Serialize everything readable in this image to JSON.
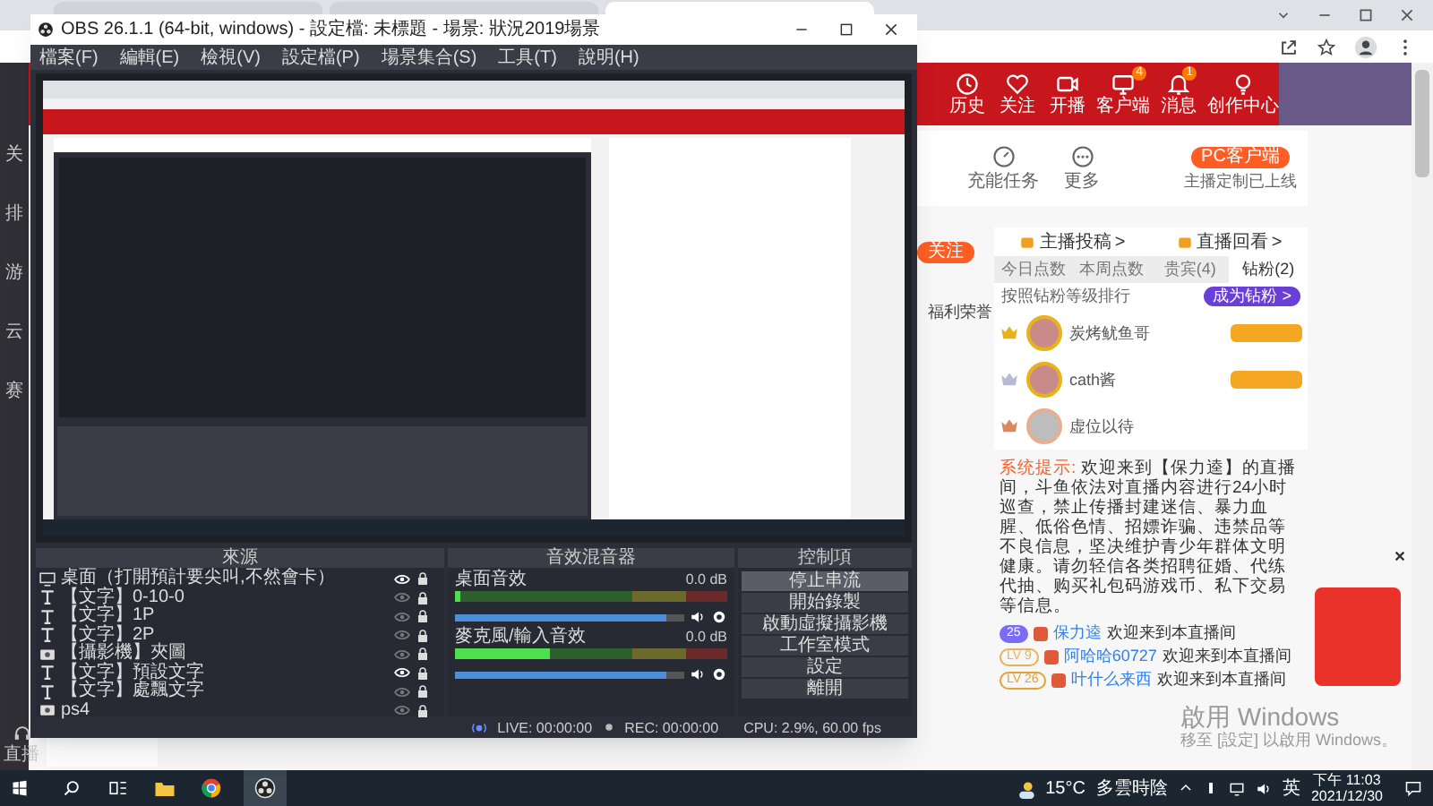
{
  "browser": {
    "tabs": [
      {
        "selected": false
      },
      {
        "selected": false
      },
      {
        "selected": true
      }
    ]
  },
  "sidebar": {
    "items": [
      "关",
      "排",
      "游",
      "云",
      "赛"
    ]
  },
  "header": {
    "nav_items": [
      {
        "label": "历史",
        "kind": "clock"
      },
      {
        "label": "关注",
        "kind": "heart"
      },
      {
        "label": "开播",
        "kind": "camera"
      },
      {
        "label": "客户端",
        "kind": "client",
        "badge": "4"
      },
      {
        "label": "消息",
        "kind": "bell",
        "badge": "1"
      },
      {
        "label": "创作中心",
        "kind": "bulb"
      }
    ]
  },
  "tools": {
    "items": [
      {
        "label": "充能任务",
        "kind": "gauge"
      },
      {
        "label": "更多",
        "kind": "more"
      }
    ],
    "client_button": "PC客户端",
    "client_note": "主播定制已上线"
  },
  "follow_button": "关注",
  "side_note": "福利荣誉",
  "links": [
    {
      "label": "主播投稿",
      "arrow": ">"
    },
    {
      "label": "直播回看",
      "arrow": ">"
    }
  ],
  "rank_tabs": [
    {
      "label": "今日点数",
      "selected": false
    },
    {
      "label": "本周点数",
      "selected": false
    },
    {
      "label": "贵宾(4)",
      "selected": false
    },
    {
      "label": "钻粉(2)",
      "selected": true
    }
  ],
  "rank_hint": "按照钻粉等级排行",
  "join_button": "成为钻粉 >",
  "rank": [
    {
      "name": "炭烤鱿鱼哥",
      "color": "#e8b21c",
      "avatar": true
    },
    {
      "name": "cath酱",
      "color": "#b9b9d6",
      "avatar": true
    },
    {
      "name": "虚位以待",
      "color": "#d98a5a",
      "avatar": false
    }
  ],
  "notice": {
    "label": "系统提示:",
    "text": "欢迎来到【保力逵】的直播间，斗鱼依法对直播内容进行24小时巡查，禁止传播封建迷信、暴力血腥、低俗色情、招嫖诈骗、违禁品等不良信息，坚决维护青少年群体文明健康。请勿轻信各类招聘征婚、代练代抽、购买礼包码游戏币、私下交易等信息。"
  },
  "chat": [
    {
      "level": "25",
      "color": "#7b6cf6",
      "user": "保力逵",
      "message": "欢迎来到本直播间"
    },
    {
      "level": "LV 9",
      "color": "#e3b25a",
      "user": "阿哈哈60727",
      "message": "欢迎来到本直播间"
    },
    {
      "level": "LV 26",
      "color": "#e8a030",
      "user": "叶什么来西",
      "message": "欢迎来到本直播间"
    }
  ],
  "activation": {
    "title": "啟用 Windows",
    "note": "移至 [設定] 以啟用 Windows。"
  },
  "live_label": "直播",
  "obs": {
    "title": "OBS 26.1.1 (64-bit, windows) - 設定檔: 未標題 - 場景: 狀況2019場景",
    "menu": [
      "檔案(F)",
      "編輯(E)",
      "檢視(V)",
      "設定檔(P)",
      "場景集合(S)",
      "工具(T)",
      "說明(H)"
    ],
    "sources_title": "來源",
    "sources": [
      {
        "label": "桌面（打開預計要尖叫,不然會卡）",
        "kind": "monitor",
        "visible": true
      },
      {
        "label": "【文字】0-10-0",
        "kind": "text",
        "visible": false
      },
      {
        "label": "【文字】1P",
        "kind": "text",
        "visible": false
      },
      {
        "label": "【文字】2P",
        "kind": "text",
        "visible": false
      },
      {
        "label": "【攝影機】夾圖",
        "kind": "camera",
        "visible": false
      },
      {
        "label": "【文字】預設文字",
        "kind": "text",
        "visible": true
      },
      {
        "label": "【文字】處飄文字",
        "kind": "text",
        "visible": false
      },
      {
        "label": "ps4",
        "kind": "camera",
        "visible": false
      }
    ],
    "mixer_title": "音效混音器",
    "channels": [
      {
        "name": "桌面音效",
        "reading": "0.0 dB",
        "level": 0.02,
        "volume": {
          "level": 0.92
        }
      },
      {
        "name": "麥克風/輸入音效",
        "reading": "0.0 dB",
        "level": 0.35,
        "volume": {
          "level": 0.92
        }
      }
    ],
    "controls_title": "控制項",
    "controls": [
      "停止串流",
      "開始錄製",
      "啟動虛擬攝影機",
      "工作室模式",
      "設定",
      "離開"
    ],
    "status": {
      "live": "LIVE: 00:00:00",
      "rec": "REC: 00:00:00",
      "cpu": "CPU: 2.9%, 60.00 fps"
    }
  },
  "taskbar": {
    "weather": "15°C",
    "forecast": "多雲時陰",
    "ime": "英",
    "time": "下午 11:03",
    "date": "2021/12/30"
  }
}
